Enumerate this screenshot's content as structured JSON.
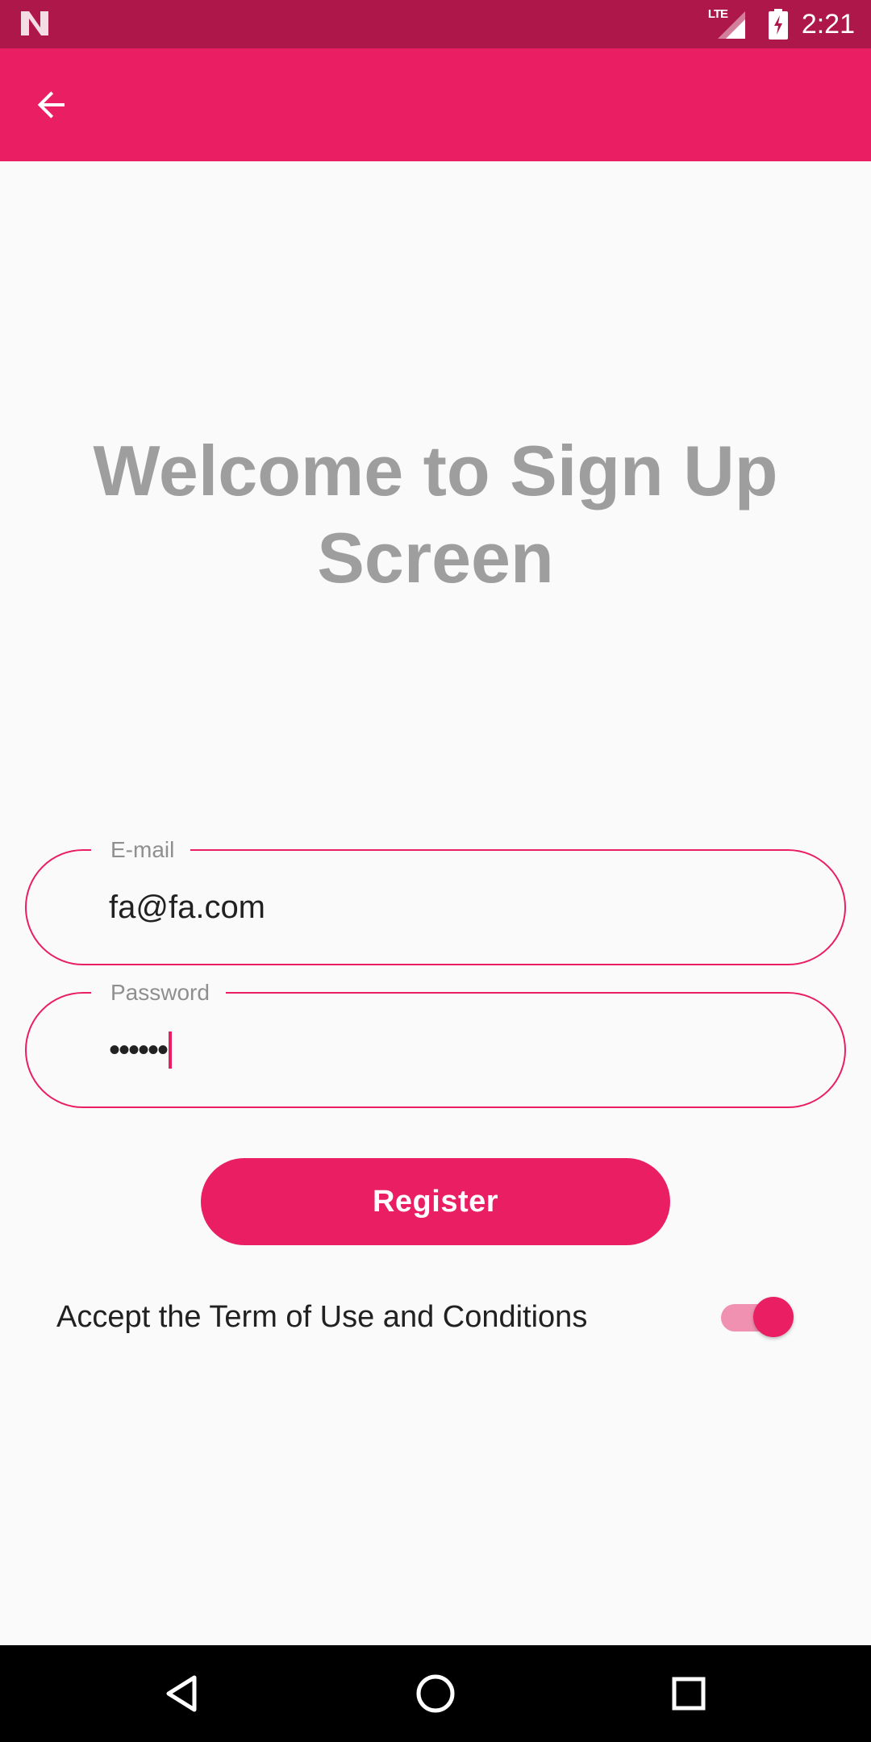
{
  "status_bar": {
    "network": "LTE",
    "time": "2:21",
    "icons": [
      "notification-n-icon",
      "lte-signal-icon",
      "battery-charging-icon"
    ]
  },
  "app_bar": {
    "back_icon": "arrow-back-icon",
    "color": "#e91e63"
  },
  "main": {
    "title": "Welcome to Sign Up Screen",
    "email_field": {
      "label": "E-mail",
      "value": "fa@fa.com"
    },
    "password_field": {
      "label": "Password",
      "masked_value": "••••••"
    },
    "register_label": "Register",
    "terms_label": "Accept the Term of Use and Conditions",
    "terms_accepted": true
  },
  "nav_bar": {
    "icons": [
      "nav-back-icon",
      "nav-home-icon",
      "nav-recent-icon"
    ]
  },
  "colors": {
    "primary": "#e91e63",
    "primary_dark": "#ad1749",
    "title_gray": "#9e9e9e",
    "background": "#fafafa"
  }
}
